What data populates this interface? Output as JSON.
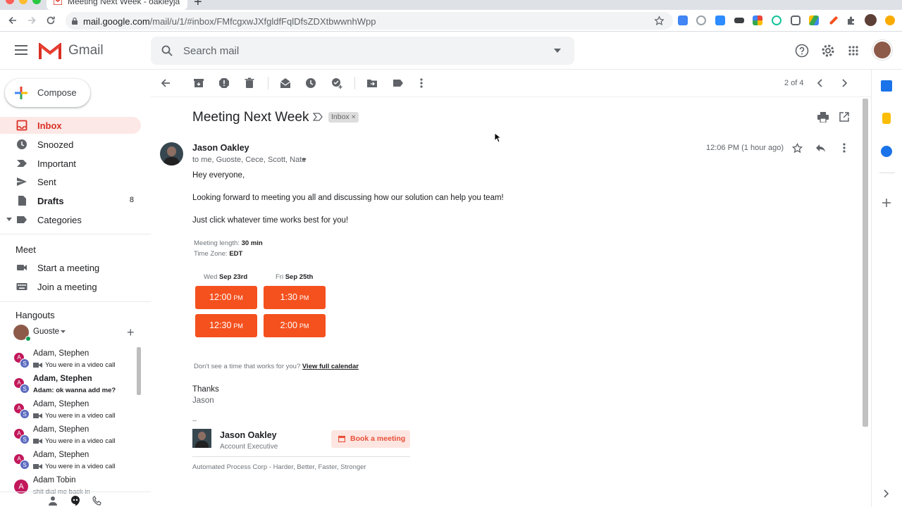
{
  "browser": {
    "tab_title": "Meeting Next Week - oakleyja",
    "url_host": "mail.google.com",
    "url_path": "/mail/u/1/#inbox/FMfcgxwJXfgldfFqlDfsZDXtbwwnhWpp",
    "new_tab": "+"
  },
  "gmail": {
    "logo_text": "Gmail",
    "search_placeholder": "Search mail"
  },
  "sidebar": {
    "compose_label": "Compose",
    "items": [
      {
        "label": "Inbox",
        "icon": "inbox-icon",
        "count": ""
      },
      {
        "label": "Snoozed",
        "icon": "clock-icon",
        "count": ""
      },
      {
        "label": "Important",
        "icon": "important-icon",
        "count": ""
      },
      {
        "label": "Sent",
        "icon": "send-icon",
        "count": ""
      },
      {
        "label": "Drafts",
        "icon": "draft-icon",
        "count": "8"
      },
      {
        "label": "Categories",
        "icon": "label-icon",
        "count": ""
      }
    ],
    "meet": {
      "heading": "Meet",
      "start": "Start a meeting",
      "join": "Join a meeting"
    },
    "hangouts": {
      "heading": "Hangouts",
      "user": "Guoste",
      "add": "+",
      "conversations": [
        {
          "name": "Adam, Stephen",
          "message": "You were in a video call",
          "bold": false,
          "video": true
        },
        {
          "name": "Adam, Stephen",
          "message": "Adam: ok wanna add me?",
          "bold": true,
          "video": false
        },
        {
          "name": "Adam, Stephen",
          "message": "You were in a video call",
          "bold": false,
          "video": true
        },
        {
          "name": "Adam, Stephen",
          "message": "You were in a video call",
          "bold": false,
          "video": true
        },
        {
          "name": "Adam, Stephen",
          "message": "You were in a video call",
          "bold": false,
          "video": true
        },
        {
          "name": "Adam Tobin",
          "message": "shit dial me back in",
          "bold": false,
          "video": false
        }
      ]
    }
  },
  "toolbar": {
    "pager": "2 of 4"
  },
  "message": {
    "subject": "Meeting Next Week",
    "label_badge": "Inbox ×",
    "sender": "Jason Oakley",
    "recipients": "to me, Guoste, Cece, Scott, Nate",
    "time": "12:06 PM (1 hour ago)",
    "greeting": "Hey everyone,",
    "line1": "Looking forward to meeting you all and discussing how our solution can help you team!",
    "line2": "Just click whatever time works best for you!",
    "meeting_length_label": "Meeting length:",
    "meeting_length_value": "30 min",
    "timezone_label": "Time Zone:",
    "timezone_value": "EDT",
    "days": [
      {
        "weekday": "Wed",
        "date": "Sep 23rd",
        "slots": [
          {
            "time": "12:00",
            "ampm": "PM"
          },
          {
            "time": "12:30",
            "ampm": "PM"
          }
        ]
      },
      {
        "weekday": "Fri",
        "date": "Sep 25th",
        "slots": [
          {
            "time": "1:30",
            "ampm": "PM"
          },
          {
            "time": "2:00",
            "ampm": "PM"
          }
        ]
      }
    ],
    "no_time_text": "Don't see a time that works for you?",
    "view_calendar": "View full calendar",
    "thanks": "Thanks",
    "sign": "Jason",
    "sig_sep": "--",
    "sig_name": "Jason Oakley",
    "sig_title": "Account Executive",
    "book_button": "Book a meeting",
    "company": "Automated Process Corp - Harder, Better, Faster, Stronger"
  },
  "colors": {
    "accent_red": "#d93025",
    "slot_orange": "#f4511e",
    "active_nav_bg": "#fce8e6"
  }
}
